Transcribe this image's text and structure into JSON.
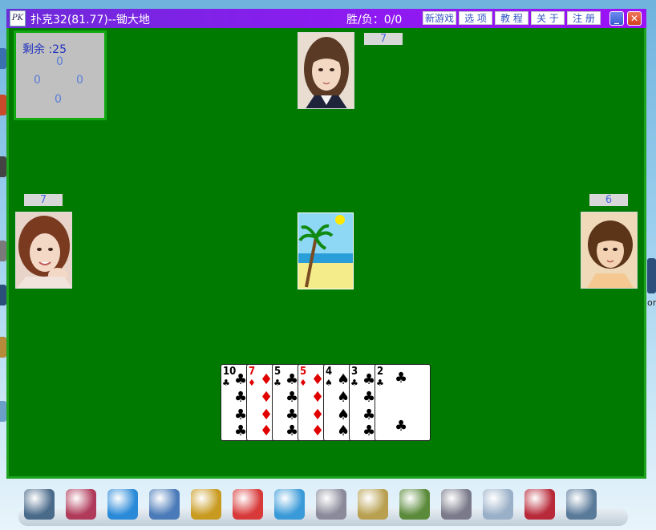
{
  "window": {
    "title": "扑克32(81.77)--锄大地",
    "score": "胜/负：0/0",
    "menu": [
      "新游戏",
      "选 项",
      "教 程",
      "关 于",
      "注 册"
    ]
  },
  "remain": {
    "label": "剩余 :25",
    "top": "0",
    "left": "0",
    "right": "0",
    "bottom": "0"
  },
  "players": {
    "top_count": "7",
    "left_count": "7",
    "right_count": "6"
  },
  "hand": [
    {
      "rank": "10",
      "suit": "♣",
      "color": "black"
    },
    {
      "rank": "7",
      "suit": "♦",
      "color": "red"
    },
    {
      "rank": "5",
      "suit": "♣",
      "color": "black"
    },
    {
      "rank": "5",
      "suit": "♦",
      "color": "red"
    },
    {
      "rank": "4",
      "suit": "♠",
      "color": "black"
    },
    {
      "rank": "3",
      "suit": "♣",
      "color": "black"
    },
    {
      "rank": "2",
      "suit": "♣",
      "color": "black"
    }
  ],
  "desktop": {
    "right_label": "on"
  },
  "dock_icons": [
    "computer-icon",
    "picture-icon",
    "network-icon",
    "pen-icon",
    "gramophone-icon",
    "tools-icon",
    "search-icon",
    "document-icon",
    "notes-icon",
    "image-editor-icon",
    "drive-icon",
    "list-icon",
    "help-icon",
    "camera-icon"
  ],
  "colors": {
    "felt": "#007a00",
    "title_bar": "#8b1cf0",
    "red_suit": "#e00000"
  }
}
